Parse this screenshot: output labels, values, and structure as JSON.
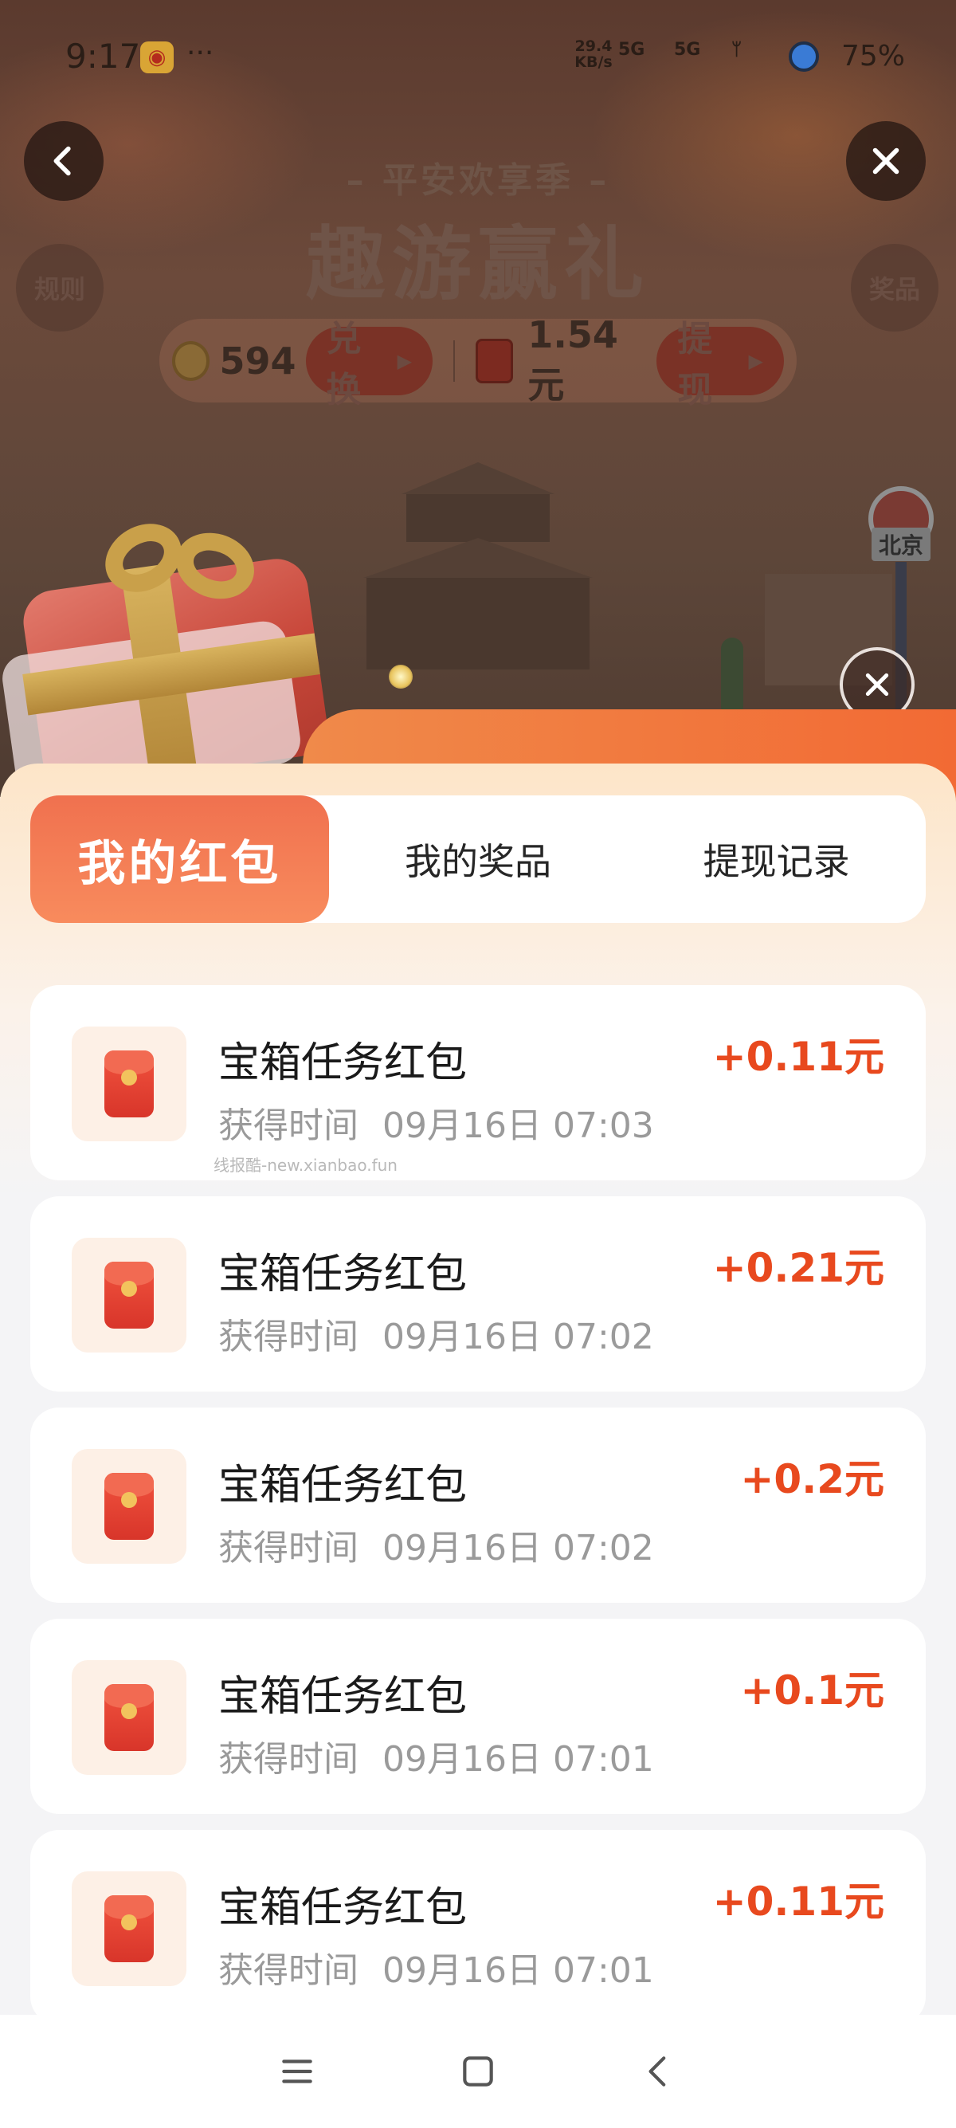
{
  "status_bar": {
    "time": "9:17",
    "dots": "···",
    "speed_value": "29.4",
    "speed_unit": "KB/s",
    "net1": "5G",
    "net2": "5G",
    "battery": "75%"
  },
  "header": {
    "subtitle": "– 平安欢享季 –",
    "title": "趣游赢礼",
    "rules_label": "规则",
    "prizes_label": "奖品"
  },
  "balance": {
    "coins": "594",
    "exchange_label": "兑换",
    "cash": "1.54元",
    "withdraw_label": "提现"
  },
  "scene": {
    "city_sign": "北京"
  },
  "tabs": [
    {
      "label": "我的红包",
      "active": true
    },
    {
      "label": "我的奖品",
      "active": false
    },
    {
      "label": "提现记录",
      "active": false
    }
  ],
  "records": [
    {
      "title": "宝箱任务红包",
      "time_label": "获得时间",
      "time": "09月16日 07:03",
      "amount": "+0.11元"
    },
    {
      "title": "宝箱任务红包",
      "time_label": "获得时间",
      "time": "09月16日 07:02",
      "amount": "+0.21元"
    },
    {
      "title": "宝箱任务红包",
      "time_label": "获得时间",
      "time": "09月16日 07:02",
      "amount": "+0.2元"
    },
    {
      "title": "宝箱任务红包",
      "time_label": "获得时间",
      "time": "09月16日 07:01",
      "amount": "+0.1元"
    },
    {
      "title": "宝箱任务红包",
      "time_label": "获得时间",
      "time": "09月16日 07:01",
      "amount": "+0.11元"
    }
  ],
  "watermark": "线报酷-new.xianbao.fun",
  "colors": {
    "accent": "#e8491e",
    "tab_active": "#f0714f"
  }
}
